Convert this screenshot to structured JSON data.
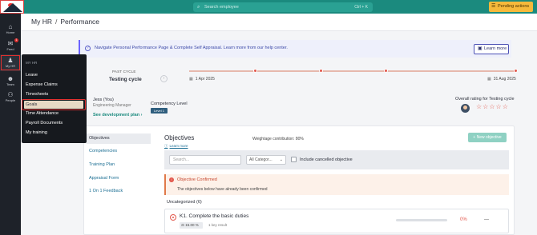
{
  "topbar": {
    "search_placeholder": "Search employee",
    "search_shortcut": "Ctrl + K",
    "pending_label": "Pending actions",
    "search_icon": "search-icon",
    "pending_icon": "list-icon"
  },
  "leftnav": {
    "items": [
      {
        "label": "Home",
        "icon": "home-icon"
      },
      {
        "label": "Feed",
        "icon": "megaphone-icon",
        "badge": "1"
      },
      {
        "label": "My HR",
        "icon": "person-icon"
      },
      {
        "label": "Team",
        "icon": "team-icon"
      },
      {
        "label": "People",
        "icon": "org-icon"
      }
    ]
  },
  "flyout": {
    "heading": "MY HR",
    "items": [
      "Leave",
      "Expense Claims",
      "Timesheets",
      "Goals",
      "Time Attendance",
      "Payroll Documents",
      "My training"
    ],
    "selected": "Goals"
  },
  "breadcrumb": {
    "parent": "My HR",
    "separator": "/",
    "current": "Performance"
  },
  "banner": {
    "text": "Navigate Personal Performance Page & Complete Self Appraisal. Learn more from our help center.",
    "button": "Learn more"
  },
  "cycle": {
    "label": "PAST CYCLE",
    "name": "Testing cycle",
    "start_date": "1 Apr 2025",
    "end_date": "31 Aug 2025"
  },
  "user": {
    "name": "Jess (You)",
    "role": "Engineering Manager",
    "dev_plan": "See development plan",
    "competency_label": "Competency Level",
    "competency_value": "Level 1",
    "overall_rating_label": "Overall rating for Testing cycle",
    "rating": 0,
    "rating_max": 5
  },
  "tabs": [
    "Objectives",
    "Competencies",
    "Training Plan",
    "Appraisal Form",
    "1 On 1 Feedback"
  ],
  "active_tab": "Objectives",
  "objectives": {
    "title": "Objectives",
    "learn_more": "Learn more",
    "weightage": "Weightage contribution: 80%",
    "new_button": "+ New objective",
    "search_placeholder": "Search...",
    "category_select": "All Categor...",
    "include_cancelled": "Include cancelled objective",
    "confirmed_title": "Objective Confirmed",
    "confirmed_body": "The objectives below have already been confirmed",
    "group": "Uncategorized (6)",
    "item": {
      "title": "K1. Complete the basic duties",
      "weight": "15.00 %",
      "results": "1 key result",
      "progress_pct": "0%",
      "progress": 0,
      "trailing": "—"
    }
  },
  "colors": {
    "brand": "#1b8a7e",
    "accent": "#e2574c",
    "pending": "#f6b93b"
  }
}
